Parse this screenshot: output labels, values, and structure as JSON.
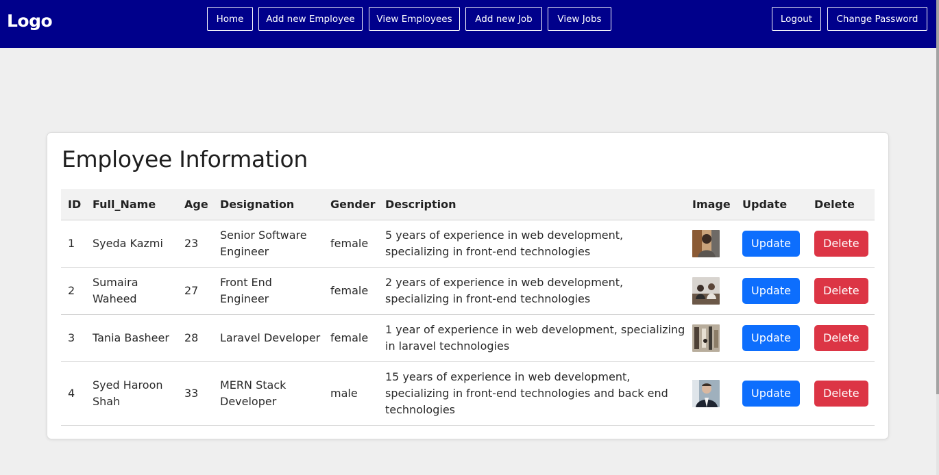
{
  "navbar": {
    "logo": "Logo",
    "bg_color": "#00008b",
    "links": [
      "Home",
      "Add new Employee",
      "View Employees",
      "Add new Job",
      "View Jobs"
    ],
    "logout": "Logout",
    "change_password": "Change Password"
  },
  "card": {
    "title": "Employee Information",
    "columns": [
      "ID",
      "Full_Name",
      "Age",
      "Designation",
      "Gender",
      "Description",
      "Image",
      "Update",
      "Delete"
    ]
  },
  "employees": [
    {
      "id": "1",
      "full_name": "Syeda Kazmi",
      "age": "23",
      "designation": "Senior Software Engineer",
      "gender": "female",
      "description": "5 years of experience in web development, specializing in front-end technologies",
      "image": "person-photo",
      "update_label": "Update",
      "delete_label": "Delete"
    },
    {
      "id": "2",
      "full_name": "Sumaira Waheed",
      "age": "27",
      "designation": "Front End Engineer",
      "gender": "female",
      "description": "2 years of experience in web development, specializing in front-end technologies",
      "image": "office-photo",
      "update_label": "Update",
      "delete_label": "Delete"
    },
    {
      "id": "3",
      "full_name": "Tania Basheer",
      "age": "28",
      "designation": "Laravel Developer",
      "gender": "female",
      "description": "1 year of experience in web development, specializing in laravel technologies",
      "image": "interior-photo",
      "update_label": "Update",
      "delete_label": "Delete"
    },
    {
      "id": "4",
      "full_name": "Syed Haroon Shah",
      "age": "33",
      "designation": "MERN Stack Developer",
      "gender": "male",
      "description": "15 years of experience in web development, specializing in front-end technologies and back end technologies",
      "image": "portrait-photo",
      "update_label": "Update",
      "delete_label": "Delete"
    }
  ],
  "colors": {
    "update_button": "#0d6efd",
    "delete_button": "#dc3545",
    "page_background": "#efefef"
  }
}
